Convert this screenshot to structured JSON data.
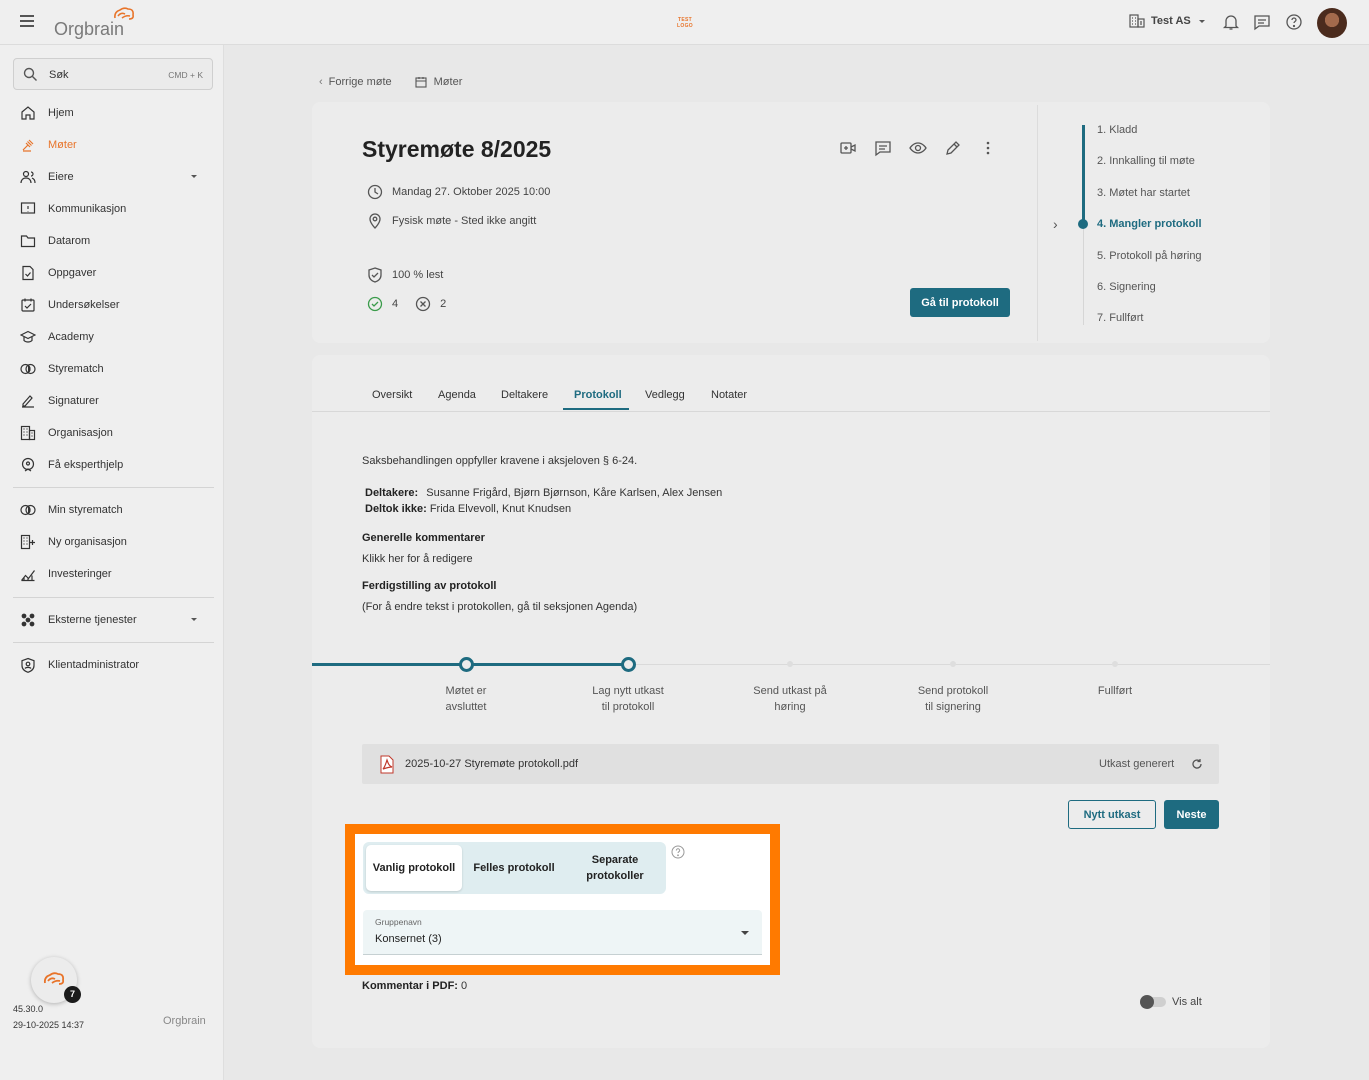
{
  "topbar": {
    "logo": "Orgbrain",
    "test_logo": "TEST LOGO",
    "org_name": "Test AS"
  },
  "sidebar": {
    "search_label": "Søk",
    "search_shortcut": "CMD + K",
    "items": [
      {
        "label": "Hjem",
        "icon": "home-icon"
      },
      {
        "label": "Møter",
        "icon": "gavel-icon",
        "active": true
      },
      {
        "label": "Eiere",
        "icon": "owners-icon",
        "has_dropdown": true
      },
      {
        "label": "Kommunikasjon",
        "icon": "chat-icon"
      },
      {
        "label": "Datarom",
        "icon": "folder-icon"
      },
      {
        "label": "Oppgaver",
        "icon": "task-icon"
      },
      {
        "label": "Undersøkelser",
        "icon": "survey-icon"
      },
      {
        "label": "Academy",
        "icon": "graduation-icon"
      },
      {
        "label": "Styrematch",
        "icon": "match-icon"
      },
      {
        "label": "Signaturer",
        "icon": "signature-icon"
      },
      {
        "label": "Organisasjon",
        "icon": "building-icon"
      },
      {
        "label": "Få eksperthjelp",
        "icon": "expert-icon"
      }
    ],
    "items2": [
      {
        "label": "Min styrematch",
        "icon": "match-icon"
      },
      {
        "label": "Ny organisasjon",
        "icon": "building-plus-icon"
      },
      {
        "label": "Investeringer",
        "icon": "chart-icon"
      }
    ],
    "external": {
      "label": "Eksterne tjenester",
      "icon": "apps-icon"
    },
    "admin": {
      "label": "Klientadministrator",
      "icon": "shield-icon"
    },
    "fab_badge": "7",
    "version": "45.30.0",
    "timestamp": "29-10-2025 14:37",
    "footer_logo": "Orgbrain"
  },
  "breadcrumb": {
    "prev": "Forrige møte",
    "meetings": "Møter"
  },
  "meeting": {
    "title": "Styremøte 8/2025",
    "datetime": "Mandag 27. Oktober 2025 10:00",
    "location": "Fysisk møte - Sted ikke angitt",
    "read_status": "100 % lest",
    "accepted_count": "4",
    "declined_count": "2",
    "go_protocol_button": "Gå til protokoll"
  },
  "steps": [
    {
      "label": "1. Kladd"
    },
    {
      "label": "2. Innkalling til møte"
    },
    {
      "label": "3. Møtet har startet"
    },
    {
      "label": "4. Mangler protokoll",
      "current": true
    },
    {
      "label": "5. Protokoll på høring"
    },
    {
      "label": "6. Signering"
    },
    {
      "label": "7. Fullført"
    }
  ],
  "tabs": [
    "Oversikt",
    "Agenda",
    "Deltakere",
    "Protokoll",
    "Vedlegg",
    "Notater"
  ],
  "active_tab": "Protokoll",
  "protocol": {
    "compliance": "Saksbehandlingen oppfyller kravene i aksjeloven § 6-24.",
    "participants_label": "Deltakere:",
    "participants": "Susanne Frigård, Bjørn Bjørnson, Kåre Karlsen, Alex Jensen",
    "absent_label": "Deltok ikke:",
    "absent": "Frida Elvevoll, Knut Knudsen",
    "general_comments_heading": "Generelle kommentarer",
    "general_comments_hint": "Klikk her for å redigere",
    "completion_heading": "Ferdigstilling av protokoll",
    "completion_hint": "(For å endre tekst i protokollen, gå til seksjonen Agenda)"
  },
  "progress": [
    {
      "line1": "Møtet er",
      "line2": "avsluttet",
      "done": true
    },
    {
      "line1": "Lag nytt utkast",
      "line2": "til protokoll",
      "done": true
    },
    {
      "line1": "Send utkast på",
      "line2": "høring",
      "done": false
    },
    {
      "line1": "Send protokoll",
      "line2": "til signering",
      "done": false
    },
    {
      "line1": "Fullført",
      "line2": "",
      "done": false
    }
  ],
  "file": {
    "name": "2025-10-27 Styremøte protokoll.pdf",
    "status": "Utkast generert"
  },
  "buttons": {
    "new_draft": "Nytt utkast",
    "next": "Neste"
  },
  "protocol_type": {
    "options": [
      "Vanlig protokoll",
      "Felles protokoll",
      "Separate protokoller"
    ],
    "selected": "Vanlig protokoll"
  },
  "group_select": {
    "label": "Gruppenavn",
    "value": "Konsernet (3)"
  },
  "pdf_comments": {
    "label": "Kommentar i PDF:",
    "value": "0"
  },
  "show_all": "Vis alt",
  "colors": {
    "accent": "#1e6b80",
    "brand_orange": "#e8742a",
    "highlight": "#ff7a00"
  }
}
